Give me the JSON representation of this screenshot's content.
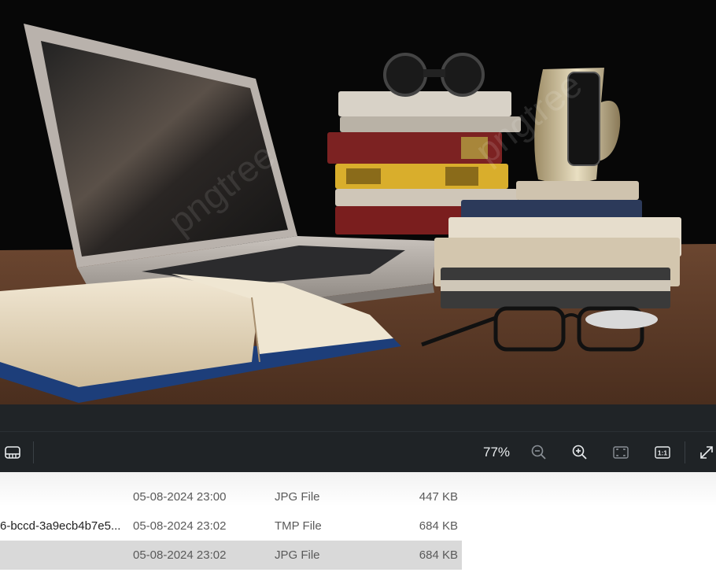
{
  "toolbar": {
    "zoom_label": "77%",
    "icons": [
      "filmstrip-icon",
      "zoom-out-icon",
      "zoom-in-icon",
      "fit-to-window-icon",
      "actual-size-icon",
      "fullscreen-icon"
    ],
    "actual_size_text": "1:1"
  },
  "file_list": {
    "rows": [
      {
        "name": "",
        "date": "05-08-2024 23:00",
        "type": "JPG File",
        "size": "447 KB"
      },
      {
        "name": "6-bccd-3a9ecb4b7e5...",
        "date": "05-08-2024 23:02",
        "type": "TMP File",
        "size": "684 KB"
      },
      {
        "name": "",
        "date": "05-08-2024 23:02",
        "type": "JPG File",
        "size": "684 KB"
      }
    ]
  },
  "photo": {
    "watermark": "pngtree",
    "colors": {
      "background": "#0a0a0a",
      "desk": "#6e4a32",
      "toolbar": "#1f2326"
    }
  }
}
